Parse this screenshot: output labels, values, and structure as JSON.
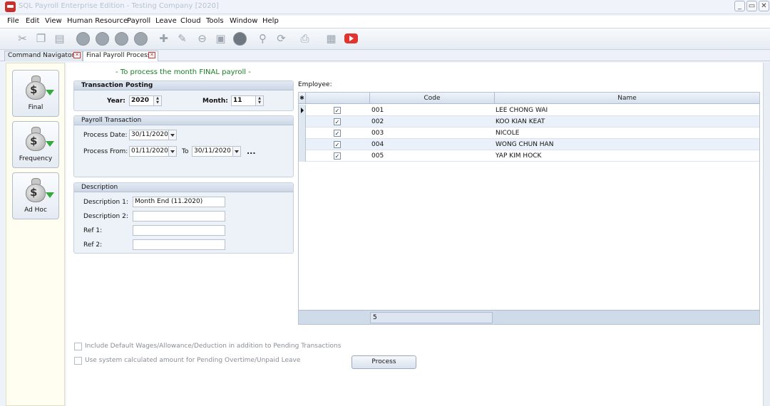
{
  "window": {
    "title": "SQL Payroll Enterprise Edition - Testing Company [2020]",
    "controls": [
      "_",
      "▭",
      "✕"
    ]
  },
  "menu": [
    "File",
    "Edit",
    "View",
    "Human Resource",
    "Payroll",
    "Leave",
    "Cloud",
    "Tools",
    "Window",
    "Help"
  ],
  "tabs": [
    {
      "label": "Command Navigator",
      "active": false
    },
    {
      "label": "Final Payroll Process",
      "active": true
    }
  ],
  "nav": [
    {
      "label": "Final",
      "icon": "money-bag-icon"
    },
    {
      "label": "Frequency",
      "icon": "money-bag-icon"
    },
    {
      "label": "Ad Hoc",
      "icon": "money-bag-icon"
    }
  ],
  "heading": "- To process the month FINAL payroll -",
  "posting": {
    "title": "Transaction Posting",
    "year_label": "Year:",
    "year": "2020",
    "month_label": "Month:",
    "month": "11"
  },
  "payroll_txn": {
    "title": "Payroll Transaction",
    "process_date_label": "Process Date:",
    "process_date": "30/11/2020",
    "process_from_label": "Process From:",
    "process_from": "01/11/2020",
    "to_label": "To",
    "process_to": "30/11/2020",
    "more": "..."
  },
  "description": {
    "title": "Description",
    "desc1_label": "Description 1:",
    "desc1": "Month End (11.2020)",
    "desc2_label": "Description 2:",
    "desc2": "",
    "ref1_label": "Ref 1:",
    "ref1": "",
    "ref2_label": "Ref 2:",
    "ref2": ""
  },
  "employee": {
    "label": "Employee:",
    "columns": [
      "Code",
      "Name"
    ],
    "rows": [
      {
        "checked": true,
        "code": "001",
        "name": "LEE CHONG WAI"
      },
      {
        "checked": true,
        "code": "002",
        "name": "KOO KIAN KEAT"
      },
      {
        "checked": true,
        "code": "003",
        "name": "NICOLE"
      },
      {
        "checked": true,
        "code": "004",
        "name": "WONG CHUN HAN"
      },
      {
        "checked": true,
        "code": "005",
        "name": "YAP KIM HOCK"
      }
    ],
    "footer_count": "5"
  },
  "options": {
    "opt1": "Include Default Wages/Allowance/Deduction in addition to Pending Transactions",
    "opt2": "Use system calculated amount for Pending Overtime/Unpaid Leave"
  },
  "process_label": "Process",
  "colors": {
    "heading": "#1a7f27",
    "brand": "#c9302c"
  }
}
